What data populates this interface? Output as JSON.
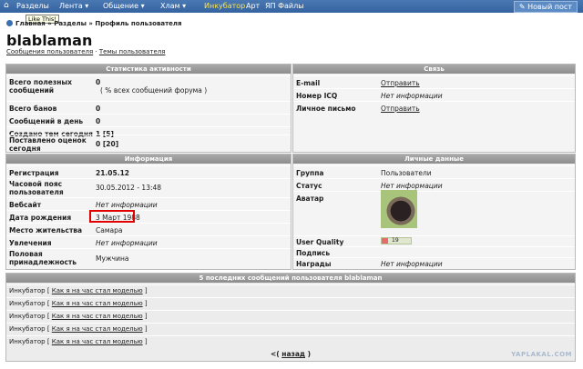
{
  "nav": {
    "items": [
      "Разделы",
      "Лента ▾",
      "Общение ▾",
      "Хлам ▾",
      "Инкубатор",
      "Арт",
      "ЯП Файлы"
    ],
    "new_post": "Новый пост",
    "tooltip": "Like This!"
  },
  "breadcrumb": "Главная » Разделы » Профиль пользователя",
  "user": {
    "name": "blablaman",
    "link_messages": "Сообщения пользователя",
    "sep": " · ",
    "link_topics": "Темы пользователя"
  },
  "stats": {
    "title": "Статистика активности",
    "rows": [
      {
        "k": "Всего полезных сообщений",
        "v": "0",
        "v2": "( % всех сообщений форума )"
      },
      {
        "k": "Всего банов",
        "v": "0"
      },
      {
        "k": "Сообщений в день",
        "v": "0"
      },
      {
        "k": "Создано тем сегодня",
        "v": "1 [5]"
      },
      {
        "k": "Поставлено оценок сегодня",
        "v": "0 [20]"
      }
    ]
  },
  "contact": {
    "title": "Связь",
    "rows": [
      {
        "k": "E-mail",
        "v": "Отправить"
      },
      {
        "k": "Номер ICQ",
        "v": "Нет информации"
      },
      {
        "k": "Личное письмо",
        "v": "Отправить"
      }
    ]
  },
  "info": {
    "title": "Информация",
    "rows": [
      {
        "k": "Регистрация",
        "v": "21.05.12"
      },
      {
        "k": "Часовой пояс пользователя",
        "v": "30.05.2012 - 13:48"
      },
      {
        "k": "Вебсайт",
        "v": "Нет информации"
      },
      {
        "k": "Дата рождения",
        "v": "3 Март 1988"
      },
      {
        "k": "Место жительства",
        "v": "Самара"
      },
      {
        "k": "Увлечения",
        "v": "Нет информации"
      },
      {
        "k": "Половая принадлежность",
        "v": "Мужчина"
      }
    ]
  },
  "personal": {
    "title": "Личные данные",
    "rows": [
      {
        "k": "Группа",
        "v": "Пользователи"
      },
      {
        "k": "Статус",
        "v": "Нет информации"
      },
      {
        "k": "Аватар",
        "v": ""
      },
      {
        "k": "User Quality",
        "v": ""
      },
      {
        "k": "Подпись",
        "v": ""
      },
      {
        "k": "Награды",
        "v": "Нет информации"
      }
    ],
    "quality_value": "19"
  },
  "posts": {
    "title": "5 последних сообщений пользователя blablaman",
    "items": [
      {
        "section": "Инкубатор",
        "link": "Как я на час стал моделью"
      },
      {
        "section": "Инкубатор",
        "link": "Как я на час стал моделью"
      },
      {
        "section": "Инкубатор",
        "link": "Как я на час стал моделью"
      },
      {
        "section": "Инкубатор",
        "link": "Как я на час стал моделью"
      },
      {
        "section": "Инкубатор",
        "link": "Как я на час стал моделью"
      }
    ],
    "pager_prefix": "<( ",
    "pager_link": "назад",
    "pager_suffix": " )"
  },
  "watermark": "YAPLAKAL.COM"
}
